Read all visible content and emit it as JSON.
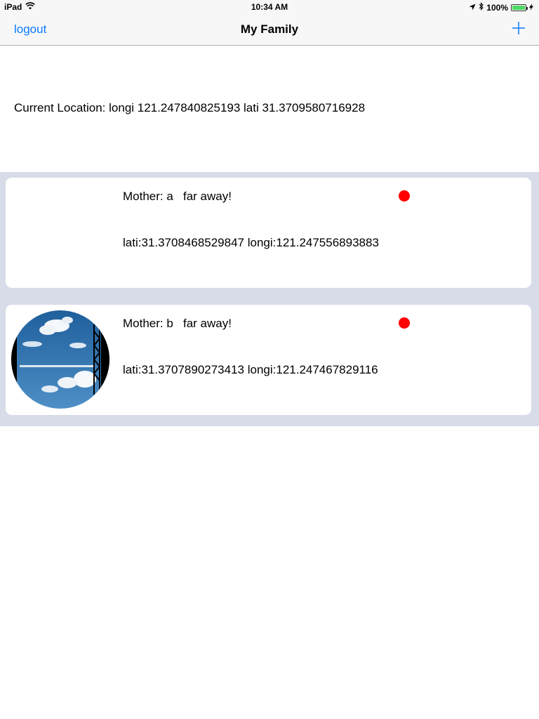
{
  "status_bar": {
    "device": "iPad",
    "time": "10:34 AM",
    "battery": "100%",
    "battery_level": 1.0
  },
  "nav": {
    "left_label": "logout",
    "title": "My Family"
  },
  "location": {
    "text": "Current Location:  longi 121.247840825193 lati 31.3709580716928"
  },
  "members": [
    {
      "name_label": "Mother: a   far away!",
      "coords": "lati:31.3708468529847 longi:121.247556893883",
      "status_color": "#ff0000",
      "has_avatar": false
    },
    {
      "name_label": "Mother: b   far away!",
      "coords": "lati:31.3707890273413 longi:121.247467829116",
      "status_color": "#ff0000",
      "has_avatar": true
    }
  ],
  "colors": {
    "accent": "#0a7aff",
    "list_background": "#d8dce9",
    "status_far": "#ff0000"
  }
}
